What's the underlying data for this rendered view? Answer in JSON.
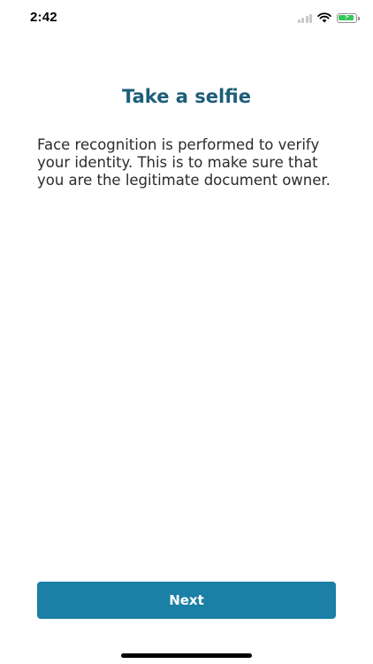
{
  "status_bar": {
    "time": "2:42",
    "battery_color": "#34c759",
    "icons": [
      "cellular-signal-icon",
      "wifi-icon",
      "battery-charging-icon"
    ]
  },
  "screen": {
    "title": "Take a selfie",
    "description": "Face recognition is performed to verify your identity. This is to make sure that you are the legitimate document owner.",
    "title_color": "#1c5e78"
  },
  "actions": {
    "next_label": "Next",
    "next_color": "#1b7fa6"
  }
}
